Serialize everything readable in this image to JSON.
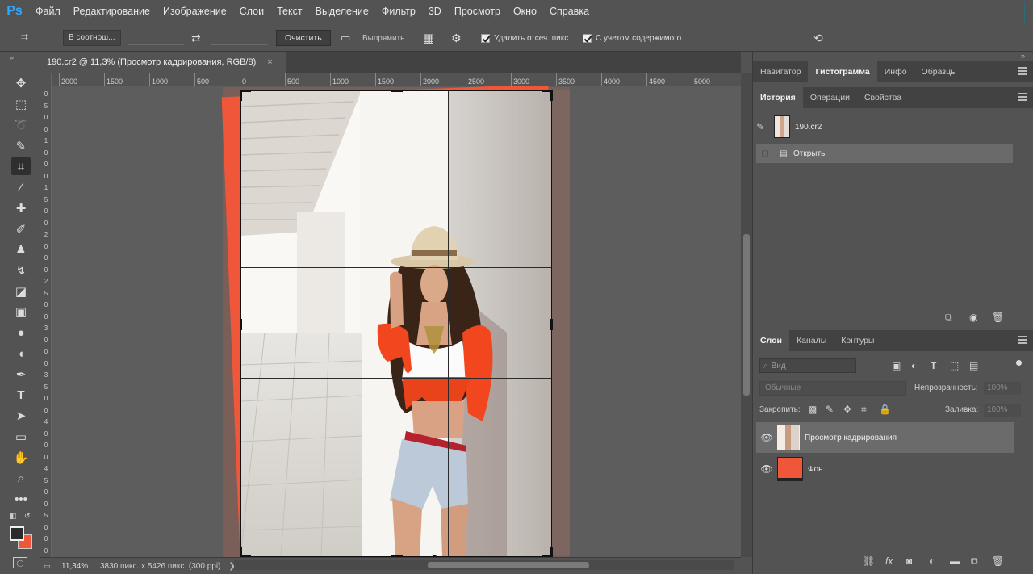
{
  "app": {
    "logo": "Ps",
    "menu": [
      "Файл",
      "Редактирование",
      "Изображение",
      "Слои",
      "Текст",
      "Выделение",
      "Фильтр",
      "3D",
      "Просмотр",
      "Окно",
      "Справка"
    ]
  },
  "options": {
    "ratio_label": "В соотнош...",
    "clear_label": "Очистить",
    "straighten_label": "Выпрямить",
    "delete_cropped_label": "Удалить отсеч. пикс.",
    "content_aware_label": "С учетом содержимого"
  },
  "document": {
    "tab_title": "190.cr2 @ 11,3% (Просмотр кадрирования, RGB/8)",
    "close_glyph": "×",
    "ruler_h": [
      "2000",
      "1500",
      "1000",
      "500",
      "0",
      "500",
      "1000",
      "1500",
      "2000",
      "2500",
      "3000",
      "3500",
      "4000",
      "4500",
      "5000"
    ],
    "ruler_v": [
      "0",
      "5",
      "0",
      "0",
      "1",
      "0",
      "0",
      "0",
      "1",
      "5",
      "0",
      "0",
      "2",
      "0",
      "0",
      "0",
      "2",
      "5",
      "0",
      "0",
      "3",
      "0",
      "0",
      "0",
      "3",
      "5",
      "0",
      "0",
      "4",
      "0",
      "0",
      "0",
      "4",
      "5",
      "0",
      "0",
      "5",
      "0",
      "0",
      "0"
    ],
    "zoom": "11,34%",
    "doc_info": "3830 пикс. x 5426 пикс. (300 ppi)",
    "status_arrow": "❯"
  },
  "panels": {
    "top_tabs": [
      "Навигатор",
      "Гистограмма",
      "Инфо",
      "Образцы"
    ],
    "top_active": "Гистограмма",
    "mid_tabs": [
      "История",
      "Операции",
      "Свойства"
    ],
    "mid_active": "История",
    "history_snapshot": "190.cr2",
    "history_items": [
      "Открыть"
    ],
    "layer_tabs": [
      "Слои",
      "Каналы",
      "Контуры"
    ],
    "layer_active": "Слои",
    "search_placeholder": "Вид",
    "blend_mode": "Обычные",
    "opacity_label": "Непрозрачность:",
    "opacity_value": "100%",
    "lock_label": "Закрепить:",
    "fill_label": "Заливка:",
    "fill_value": "100%",
    "layers": [
      {
        "name": "Просмотр кадрирования"
      },
      {
        "name": "Фон"
      }
    ],
    "fx_label": "fx"
  },
  "colors": {
    "accent_orange": "#f0563a",
    "ps_blue": "#31a8ff",
    "panel_bg": "#535353"
  }
}
